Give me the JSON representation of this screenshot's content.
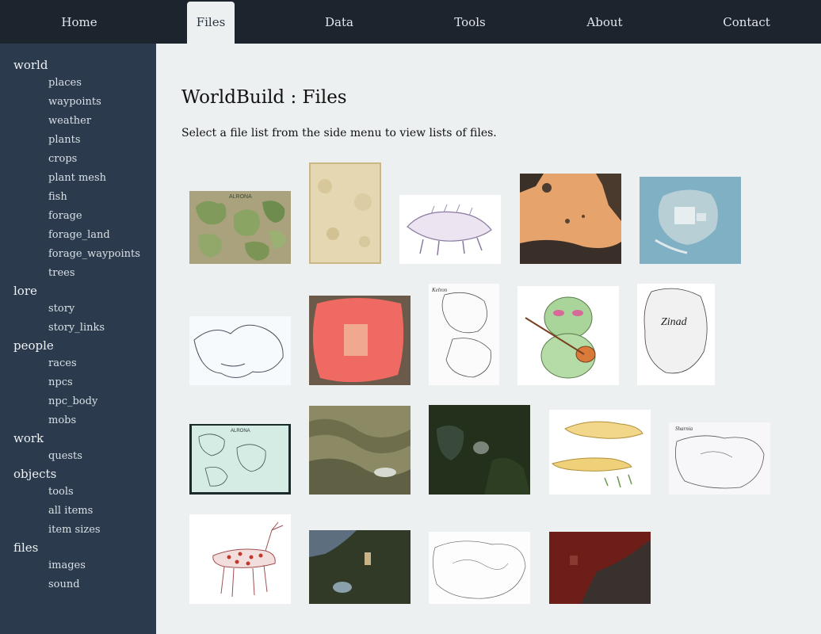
{
  "nav": {
    "home": "Home",
    "files": "Files",
    "data": "Data",
    "tools": "Tools",
    "about": "About",
    "contact": "Contact"
  },
  "sidebar": {
    "world": {
      "label": "world",
      "items": [
        "places",
        "waypoints",
        "weather",
        "plants",
        "crops",
        "plant mesh",
        "fish",
        "forage",
        "forage_land",
        "forage_waypoints",
        "trees"
      ]
    },
    "lore": {
      "label": "lore",
      "items": [
        "story",
        "story_links"
      ]
    },
    "people": {
      "label": "people",
      "items": [
        "races",
        "npcs",
        "npc_body",
        "mobs"
      ]
    },
    "work": {
      "label": "work",
      "items": [
        "quests"
      ]
    },
    "objects": {
      "label": "objects",
      "items": [
        "tools",
        "all items",
        "item sizes"
      ]
    },
    "files": {
      "label": "files",
      "items": [
        "images",
        "sound"
      ]
    }
  },
  "main": {
    "title": "WorldBuild : Files",
    "intro": "Select a file list from the side menu to view lists of files."
  },
  "thumbnail_labels": {
    "alrona": "ALRONA",
    "kelron": "Kelron",
    "zinad": "Zinad",
    "sharnia": "Sharnia"
  },
  "colors": {
    "nav_bg": "#1c242e",
    "sidebar_bg": "#2b3a4c",
    "content_bg": "#edf0f1"
  }
}
